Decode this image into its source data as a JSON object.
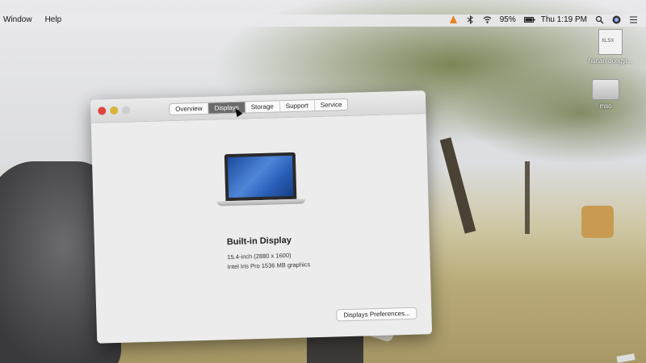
{
  "menubar": {
    "left_items": [
      "Window",
      "Help"
    ],
    "battery": "95%",
    "clock": "Thu 1:19 PM",
    "icons": [
      "vlc-icon",
      "bluetooth-icon",
      "wifi-icon",
      "battery-icon",
      "search-icon",
      "siri-icon",
      "list-icon"
    ]
  },
  "desktop": {
    "items": [
      {
        "label": "hunan dongyi...",
        "badge": "XLSX",
        "icon": "xlsx-file-icon"
      },
      {
        "label": "mso",
        "icon": "drive-icon"
      }
    ]
  },
  "window": {
    "tabs": [
      {
        "label": "Overview",
        "active": false
      },
      {
        "label": "Displays",
        "active": true
      },
      {
        "label": "Storage",
        "active": false
      },
      {
        "label": "Support",
        "active": false
      },
      {
        "label": "Service",
        "active": false
      }
    ],
    "display_name": "Built-in Display",
    "resolution": "15.4-inch (2880 x 1600)",
    "graphics": "Intel Iris Pro 1536 MB graphics",
    "preferences_button": "Displays Preferences..."
  },
  "colors": {
    "close": "#e0443e",
    "minimize": "#d9b43a",
    "active_tab": "#6a6a6a"
  }
}
